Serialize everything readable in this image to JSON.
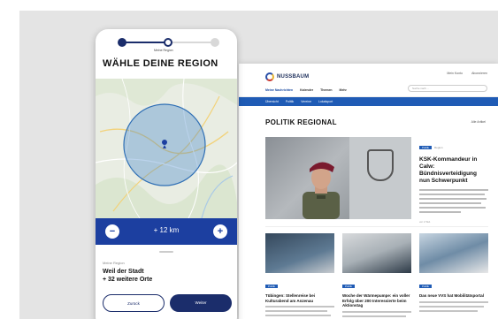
{
  "colors": {
    "brand_navy": "#1b2d6b",
    "brand_blue": "#1c3fa0",
    "accent_blue": "#1f5bb5",
    "radius_fill": "#3c82c8"
  },
  "phone": {
    "steps": {
      "current_label": "Meine Region"
    },
    "title": "WÄHLE DEINE REGION",
    "zoom": {
      "minus_label": "−",
      "value": "+ 12 km",
      "plus_label": "+"
    },
    "region": {
      "label": "Meine Region",
      "value_line1": "Weil der Stadt",
      "value_line2": "+ 32 weitere Orte"
    },
    "buttons": {
      "back": "Zurück",
      "next": "Weiter"
    }
  },
  "desktop": {
    "brand": "NUSSBAUM",
    "nav": [
      "Meine Nachrichten",
      "Kalender",
      "Themen",
      "Mehr"
    ],
    "account_label": "Mein Konto",
    "subscribe_label": "Abonnieren",
    "search_placeholder": "Suche nach ...",
    "bar_links": [
      "Übersicht",
      "Politik",
      "Vereine",
      "Lokalsport"
    ],
    "section_title": "POLITIK REGIONAL",
    "section_more": "Alle Artikel",
    "side_story": {
      "tag": "Politik",
      "meta": "Region",
      "headline": "KSK-Kommandeur in Calw: Bündnisverteidigung nun Schwerpunkt",
      "date": "vor 2 Std."
    },
    "cards": [
      {
        "tag": "Politik",
        "title": "Tübingen: Stellenreise bei Kulturabend am Anzenau"
      },
      {
        "tag": "Politik",
        "title": "Woche der Wärmepumpe: ein voller Erfolg über 200 Interessierte beim Aktionstag"
      },
      {
        "tag": "Politik",
        "title": "Das neue VVS hat Mobilitätsportal"
      }
    ]
  }
}
